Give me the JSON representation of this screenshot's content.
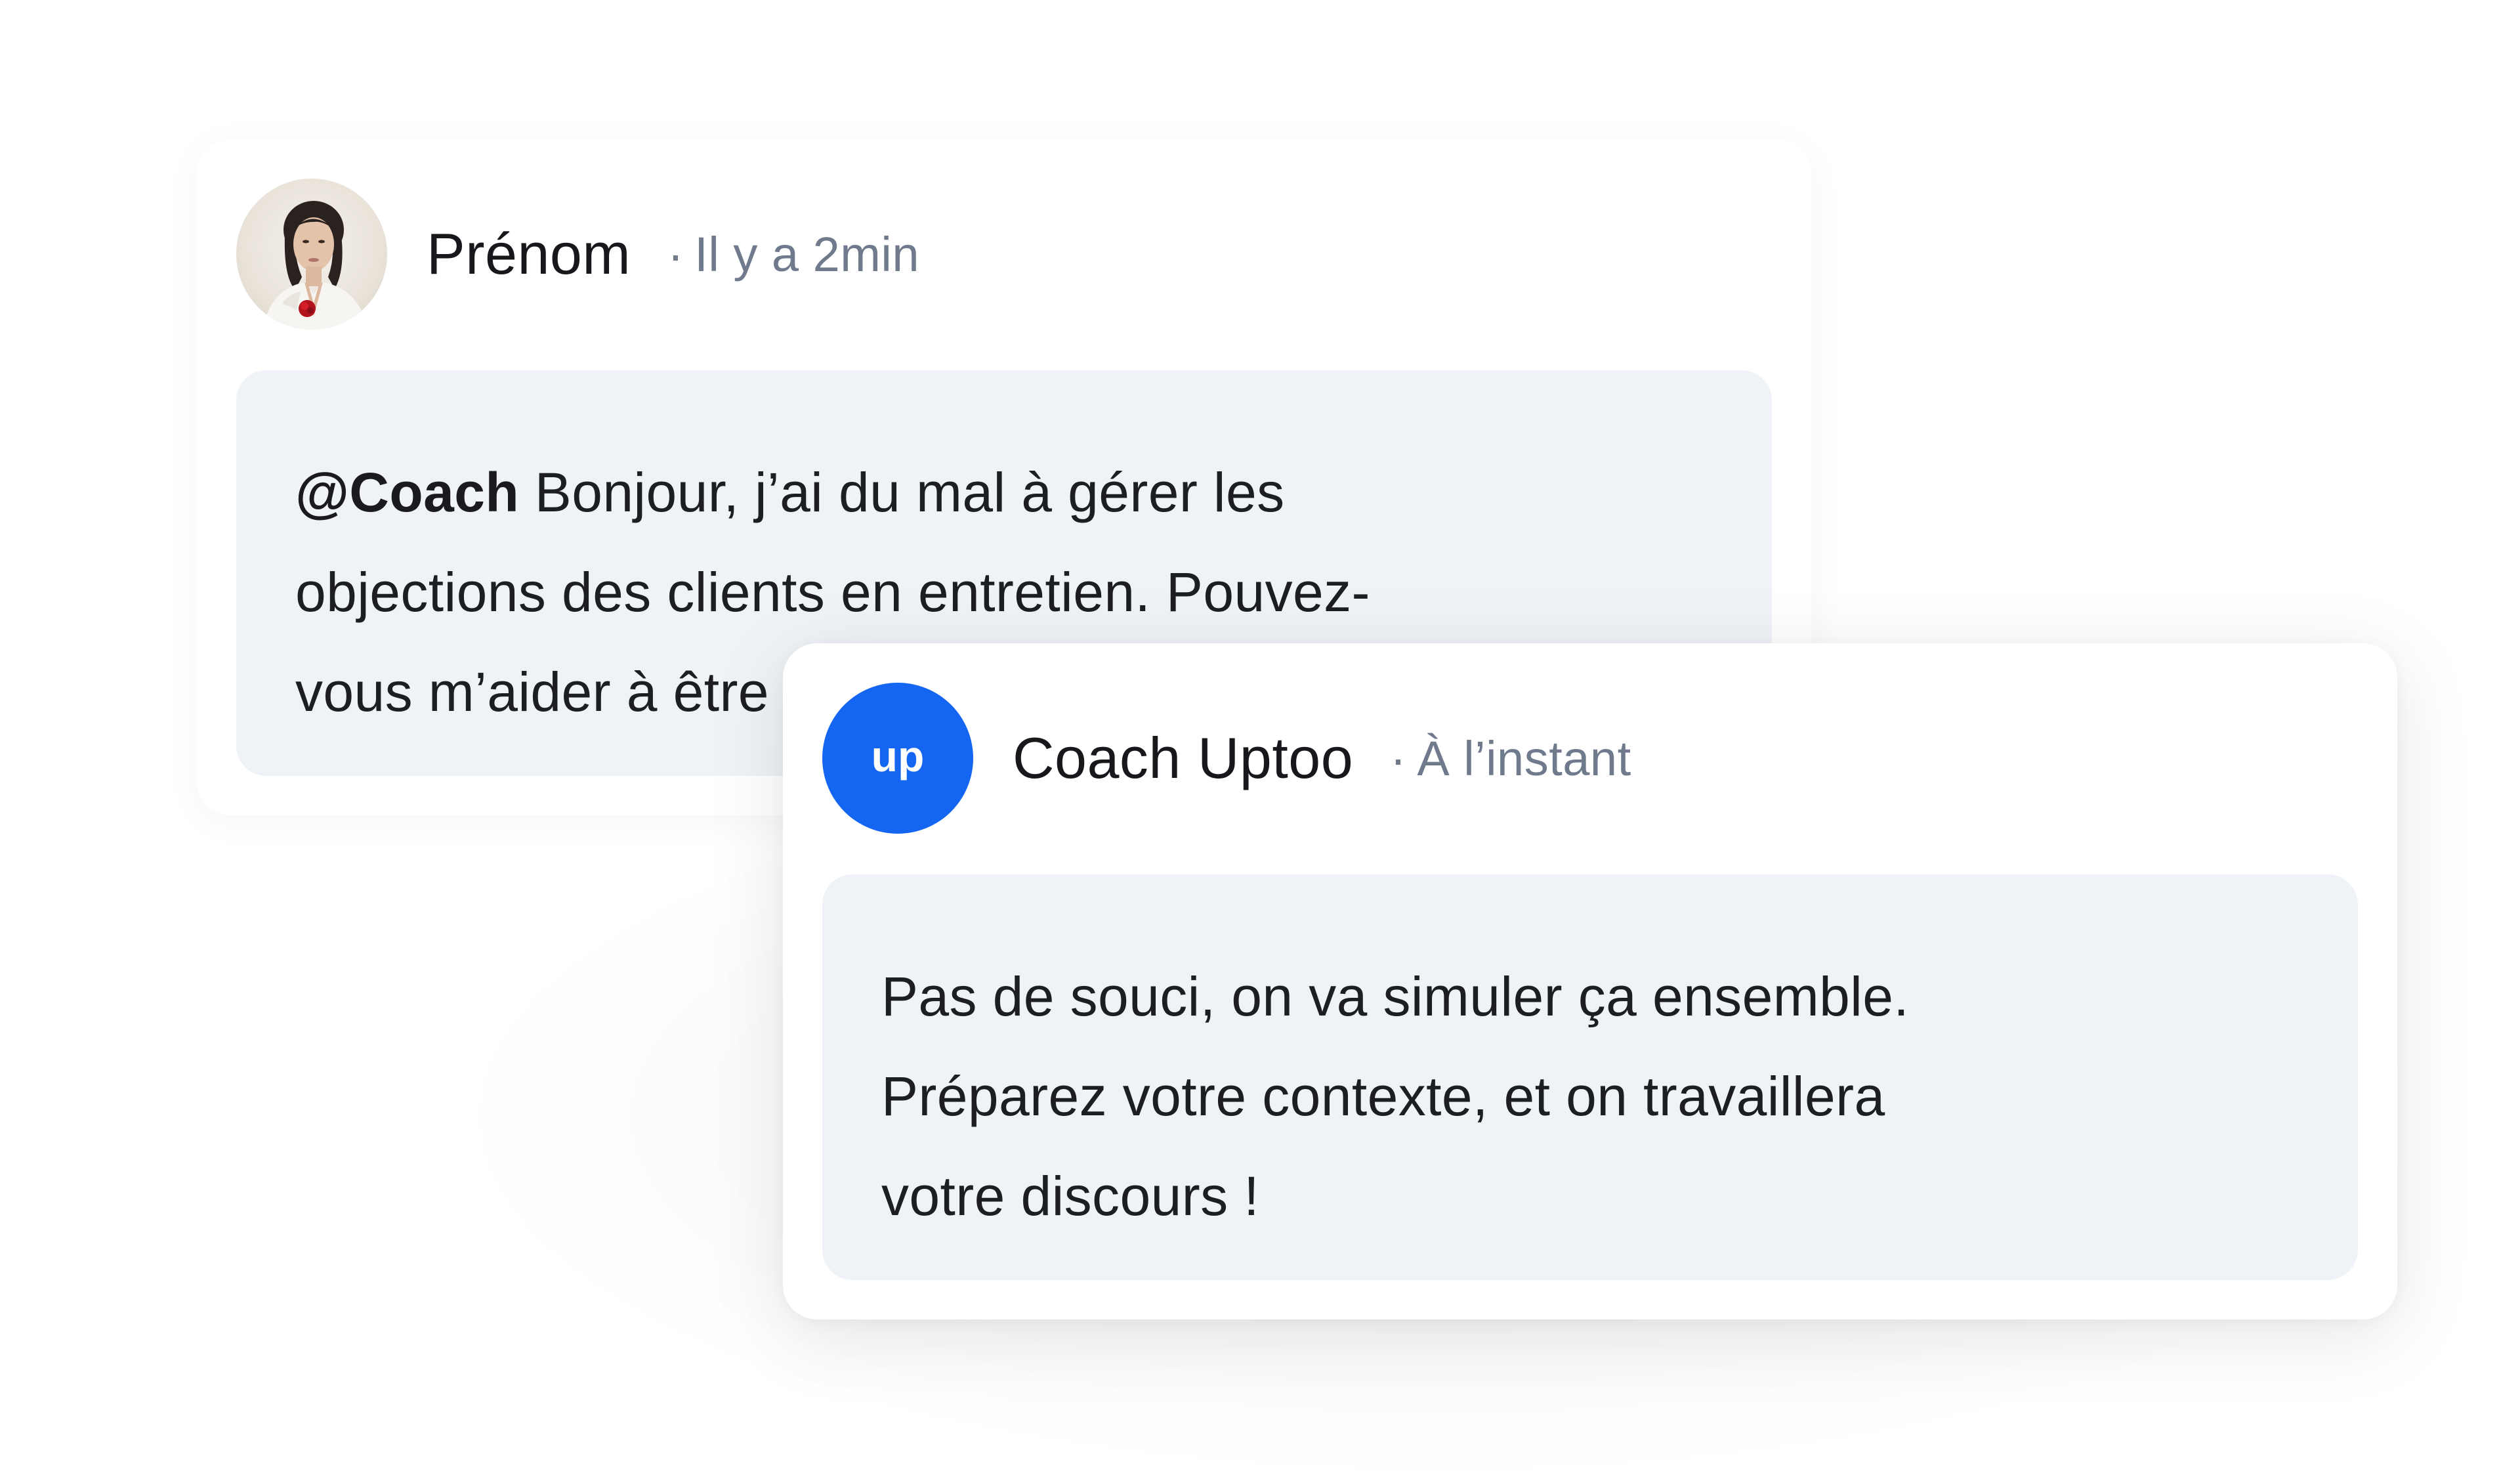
{
  "user_message": {
    "author": "Prénom",
    "time_separator": "·",
    "time": "Il y a 2min",
    "mention": "@Coach",
    "lines": [
      " Bonjour, j’ai du mal à gérer les",
      "objections des clients en entretien. Pouvez-",
      "vous m’aider à être plus convaincant ?"
    ]
  },
  "coach_message": {
    "author": "Coach Uptoo",
    "time_separator": "·",
    "time": "À l’instant",
    "avatar_logo": "up",
    "lines": [
      "Pas de souci, on va simuler ça ensemble.",
      "Préparez votre contexte, et on travaillera",
      "votre discours !"
    ]
  },
  "colors": {
    "brand_blue": "#1466f2",
    "bubble_bg": "#eff3f8",
    "timestamp_gray": "#6f7a8c"
  },
  "icons": {
    "user_avatar": "woman-portrait-avatar",
    "coach_avatar": "uptoo-logo"
  }
}
